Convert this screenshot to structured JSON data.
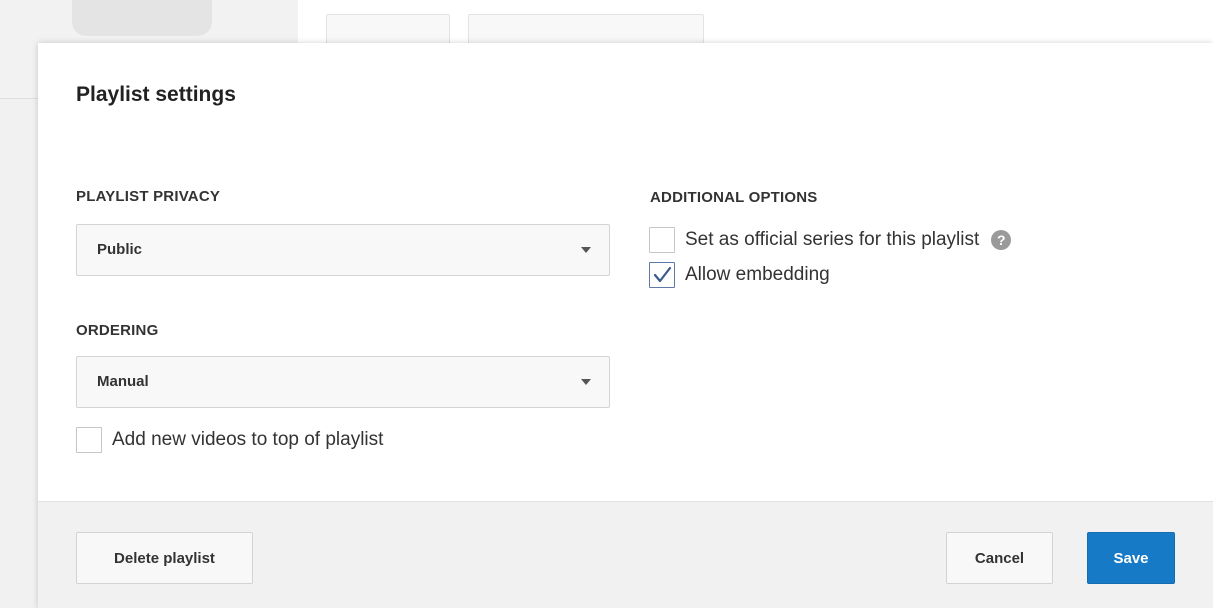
{
  "dialog": {
    "title": "Playlist settings"
  },
  "privacy": {
    "label": "PLAYLIST PRIVACY",
    "selected": "Public"
  },
  "ordering": {
    "label": "ORDERING",
    "selected": "Manual",
    "add_to_top": {
      "label": "Add new videos to top of playlist",
      "checked": false
    }
  },
  "additional": {
    "label": "ADDITIONAL OPTIONS",
    "official_series": {
      "label": "Set as official series for this playlist",
      "checked": false,
      "help_glyph": "?"
    },
    "allow_embedding": {
      "label": "Allow embedding",
      "checked": true
    }
  },
  "footer": {
    "delete_label": "Delete playlist",
    "cancel_label": "Cancel",
    "save_label": "Save"
  },
  "colors": {
    "primary": "#167ac6",
    "footer_bg": "#f1f1f1",
    "check_mark": "#3c5a8c"
  },
  "icons": {
    "dropdown": "caret-down-icon",
    "help": "help-icon",
    "check": "check-icon"
  }
}
